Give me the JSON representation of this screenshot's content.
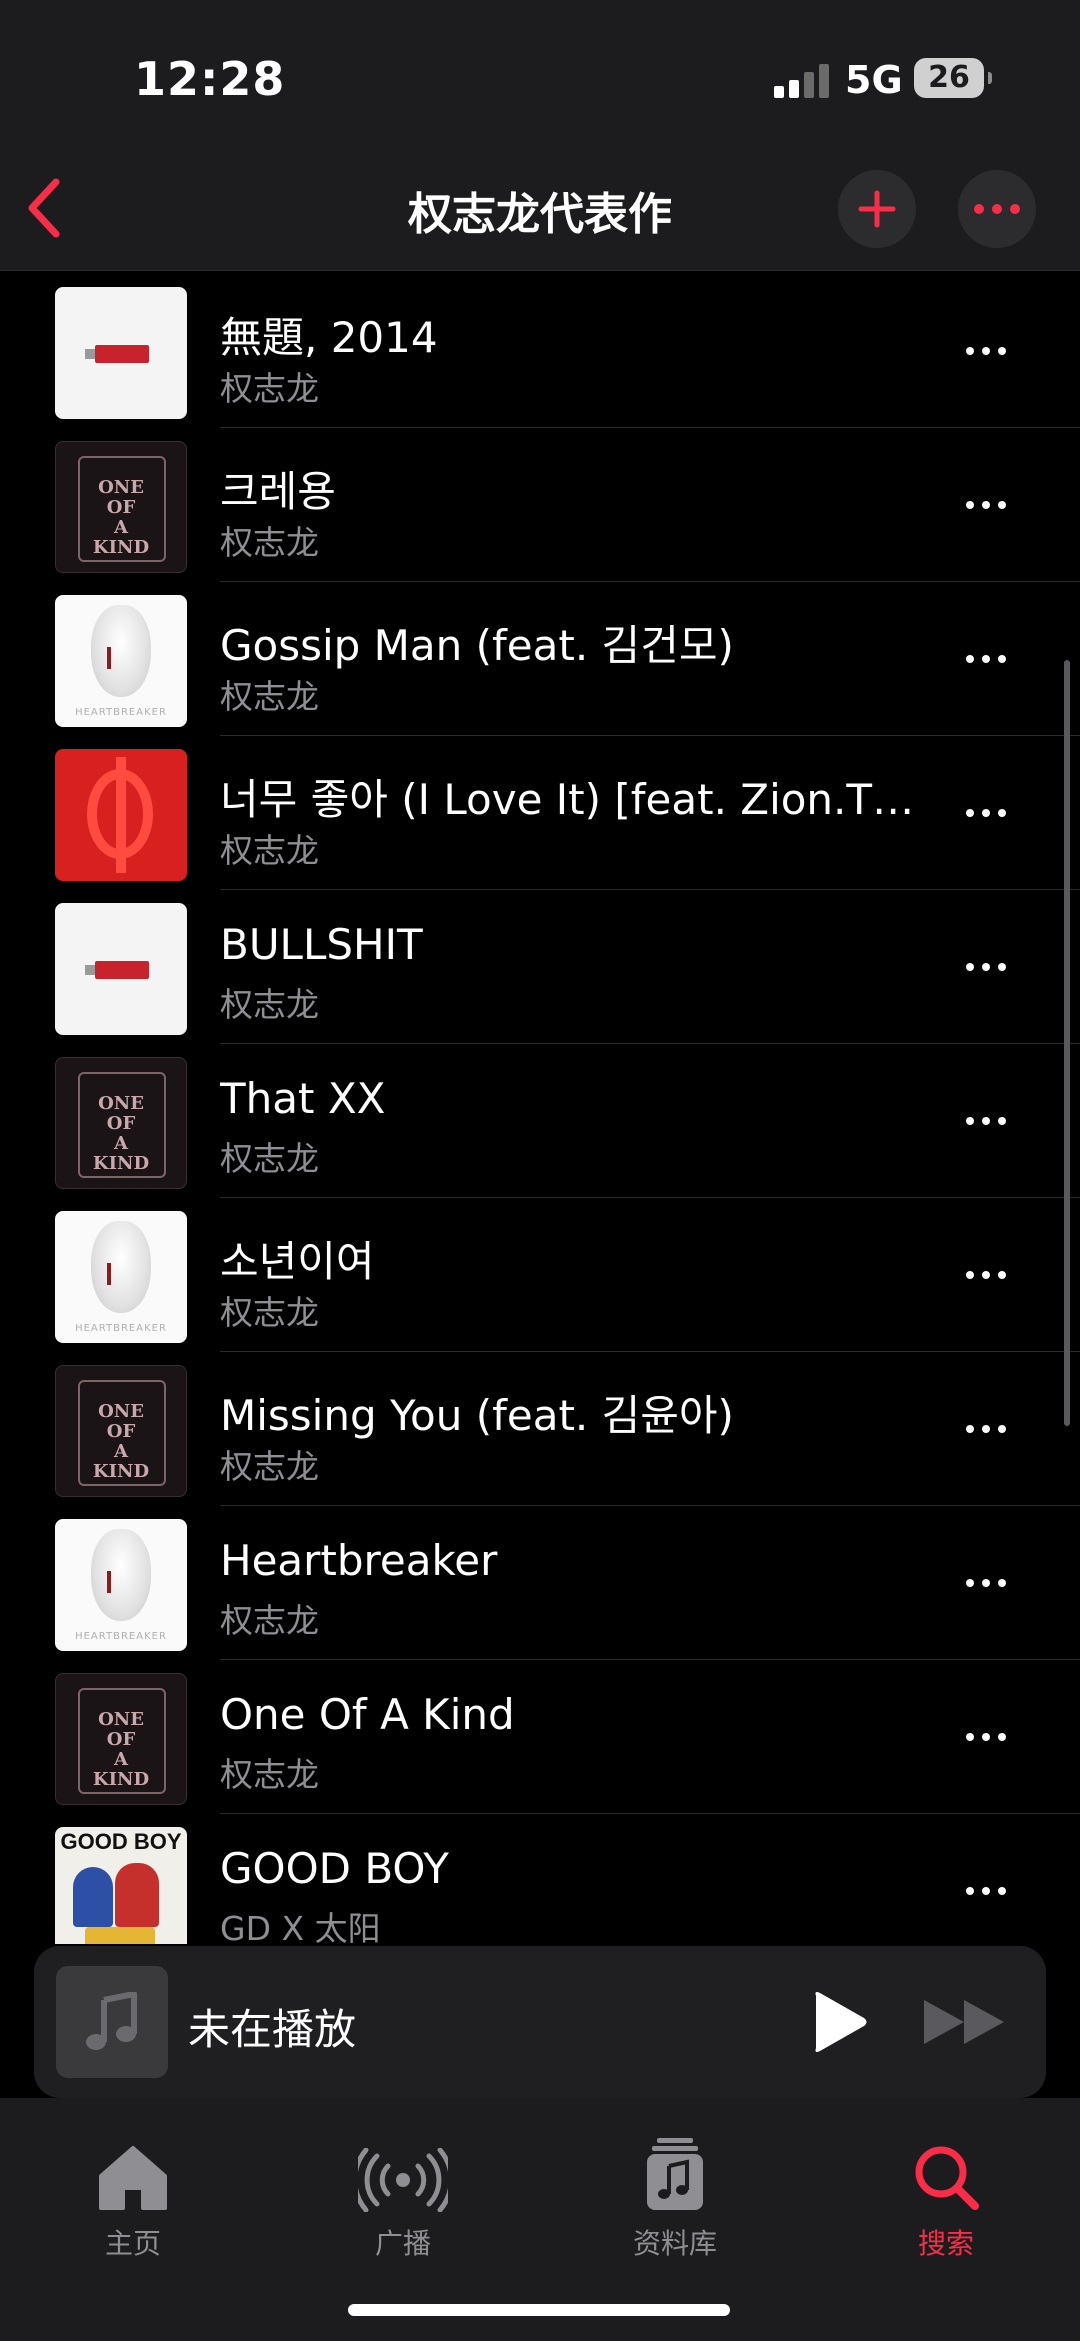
{
  "status_bar": {
    "time": "12:28",
    "network": "5G",
    "battery": "26"
  },
  "nav": {
    "title": "权志龙代表作"
  },
  "songs": [
    {
      "title": "無題, 2014",
      "artist": "权志龙",
      "art": "usb-white"
    },
    {
      "title": "크레용",
      "artist": "权志龙",
      "art": "one-of-a-kind"
    },
    {
      "title": "Gossip Man (feat. 김건모)",
      "artist": "权志龙",
      "art": "heartbreaker-mask"
    },
    {
      "title": "너무 좋아 (I Love It) [feat. Zion.T &...",
      "artist": "权志龙",
      "art": "red-logo"
    },
    {
      "title": "BULLSHIT",
      "artist": "权志龙",
      "art": "usb-white"
    },
    {
      "title": "That XX",
      "artist": "权志龙",
      "art": "one-of-a-kind"
    },
    {
      "title": "소년이여",
      "artist": "权志龙",
      "art": "heartbreaker-mask"
    },
    {
      "title": "Missing You (feat. 김윤아)",
      "artist": "权志龙",
      "art": "one-of-a-kind"
    },
    {
      "title": "Heartbreaker",
      "artist": "权志龙",
      "art": "heartbreaker-mask"
    },
    {
      "title": "One Of A Kind",
      "artist": "权志龙",
      "art": "one-of-a-kind"
    },
    {
      "title": "GOOD BOY",
      "artist": "GD X 太阳",
      "art": "good-boy"
    }
  ],
  "album_art_text": {
    "one_of_a_kind": [
      "ONE",
      "OF",
      "A",
      "KIND"
    ],
    "heartbreaker": "HEARTBREAKER",
    "good_boy": "GOOD BOY"
  },
  "mini_player": {
    "title": "未在播放"
  },
  "tabs": [
    {
      "label": "主页",
      "icon": "home-icon"
    },
    {
      "label": "广播",
      "icon": "radio-icon"
    },
    {
      "label": "资料库",
      "icon": "library-icon"
    },
    {
      "label": "搜索",
      "icon": "search-icon",
      "active": true
    }
  ],
  "colors": {
    "accent": "#fa2d48",
    "background": "#000000",
    "secondary_text": "#8e8e93",
    "bar_bg": "#1c1c1e"
  }
}
